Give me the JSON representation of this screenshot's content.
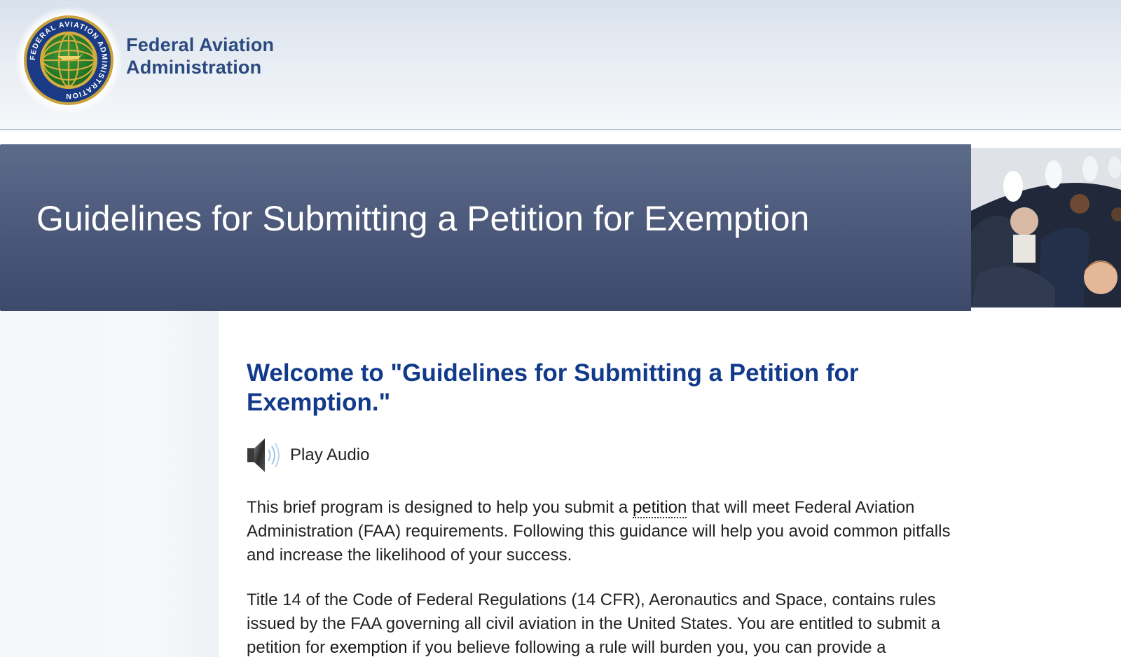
{
  "header": {
    "agency_line1": "Federal Aviation",
    "agency_line2": "Administration",
    "seal_icon": "faa-seal-icon",
    "seal_text": "FEDERAL AVIATION ADMINISTRATION"
  },
  "banner": {
    "title": "Guidelines for Submitting a Petition for Exemption",
    "photo": "airplane-cabin-passengers-photo"
  },
  "main": {
    "heading": "Welcome to \"Guidelines for Submitting a Petition for Exemption.\"",
    "audio": {
      "icon": "speaker-icon",
      "label": "Play Audio"
    },
    "paragraph1": {
      "before": "This brief program is designed to help you submit a ",
      "link": "petition",
      "after": " that will meet Federal Aviation Administration (FAA) requirements.  Following this guidance will help you avoid common pitfalls and increase the likelihood of your success."
    },
    "paragraph2": {
      "before": "Title 14 of the Code of Federal Regulations (14 CFR), Aeronautics and Space, contains rules issued by the FAA governing all civil aviation in the United States.  You are entitled to submit a petition for ",
      "link": "exemption",
      "after": " if you believe following a rule will burden you, you can provide a"
    }
  },
  "colors": {
    "agency_text": "#2c4a7f",
    "banner_top": "#5d6b8b",
    "banner_bottom": "#3e4a6c",
    "heading": "#123a8a",
    "body_text": "#222222"
  }
}
